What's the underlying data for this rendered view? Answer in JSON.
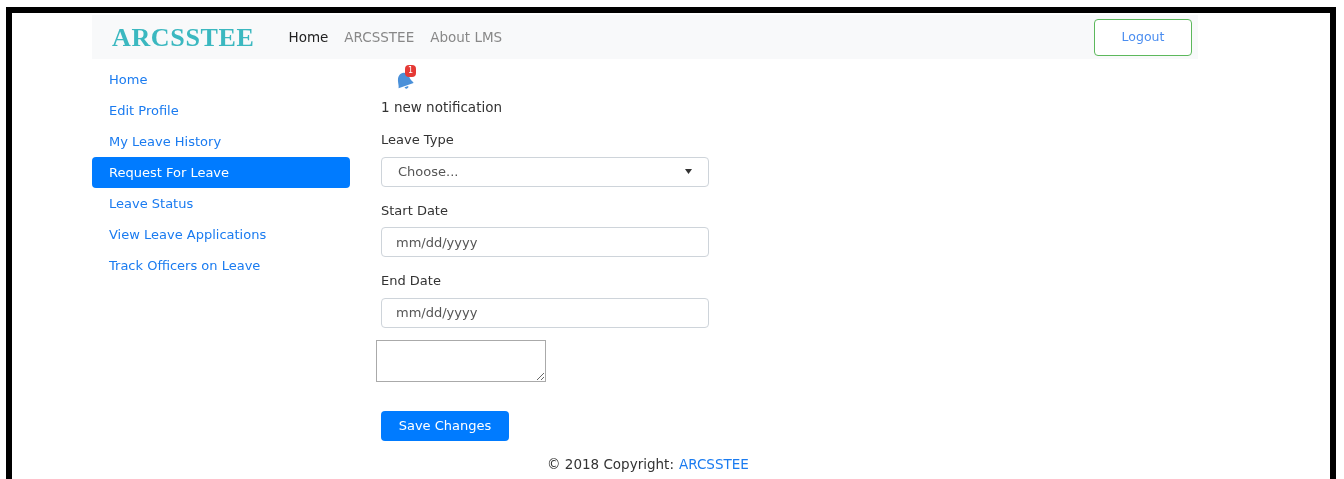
{
  "navbar": {
    "brand": "ARCSSTEE",
    "links": [
      {
        "label": "Home",
        "selected": true
      },
      {
        "label": "ARCSSTEE",
        "selected": false
      },
      {
        "label": "About LMS",
        "selected": false
      }
    ],
    "logout": "Logout"
  },
  "sidebar": {
    "items": [
      {
        "label": "Home",
        "selected": false
      },
      {
        "label": "Edit Profile",
        "selected": false
      },
      {
        "label": "My Leave History",
        "selected": false
      },
      {
        "label": "Request For Leave",
        "selected": true
      },
      {
        "label": "Leave Status",
        "selected": false
      },
      {
        "label": "View Leave Applications",
        "selected": false
      },
      {
        "label": "Track Officers on Leave",
        "selected": false
      }
    ]
  },
  "notification": {
    "badge": "1",
    "text": "1 new notification"
  },
  "form": {
    "leave_type": {
      "label": "Leave Type",
      "value": "Choose..."
    },
    "start_date": {
      "label": "Start Date",
      "placeholder": "mm/dd/yyyy"
    },
    "end_date": {
      "label": "End Date",
      "placeholder": "mm/dd/yyyy"
    },
    "save": "Save Changes"
  },
  "footer": {
    "text": "© 2018 Copyright:",
    "link": "ARCSSTEE"
  }
}
